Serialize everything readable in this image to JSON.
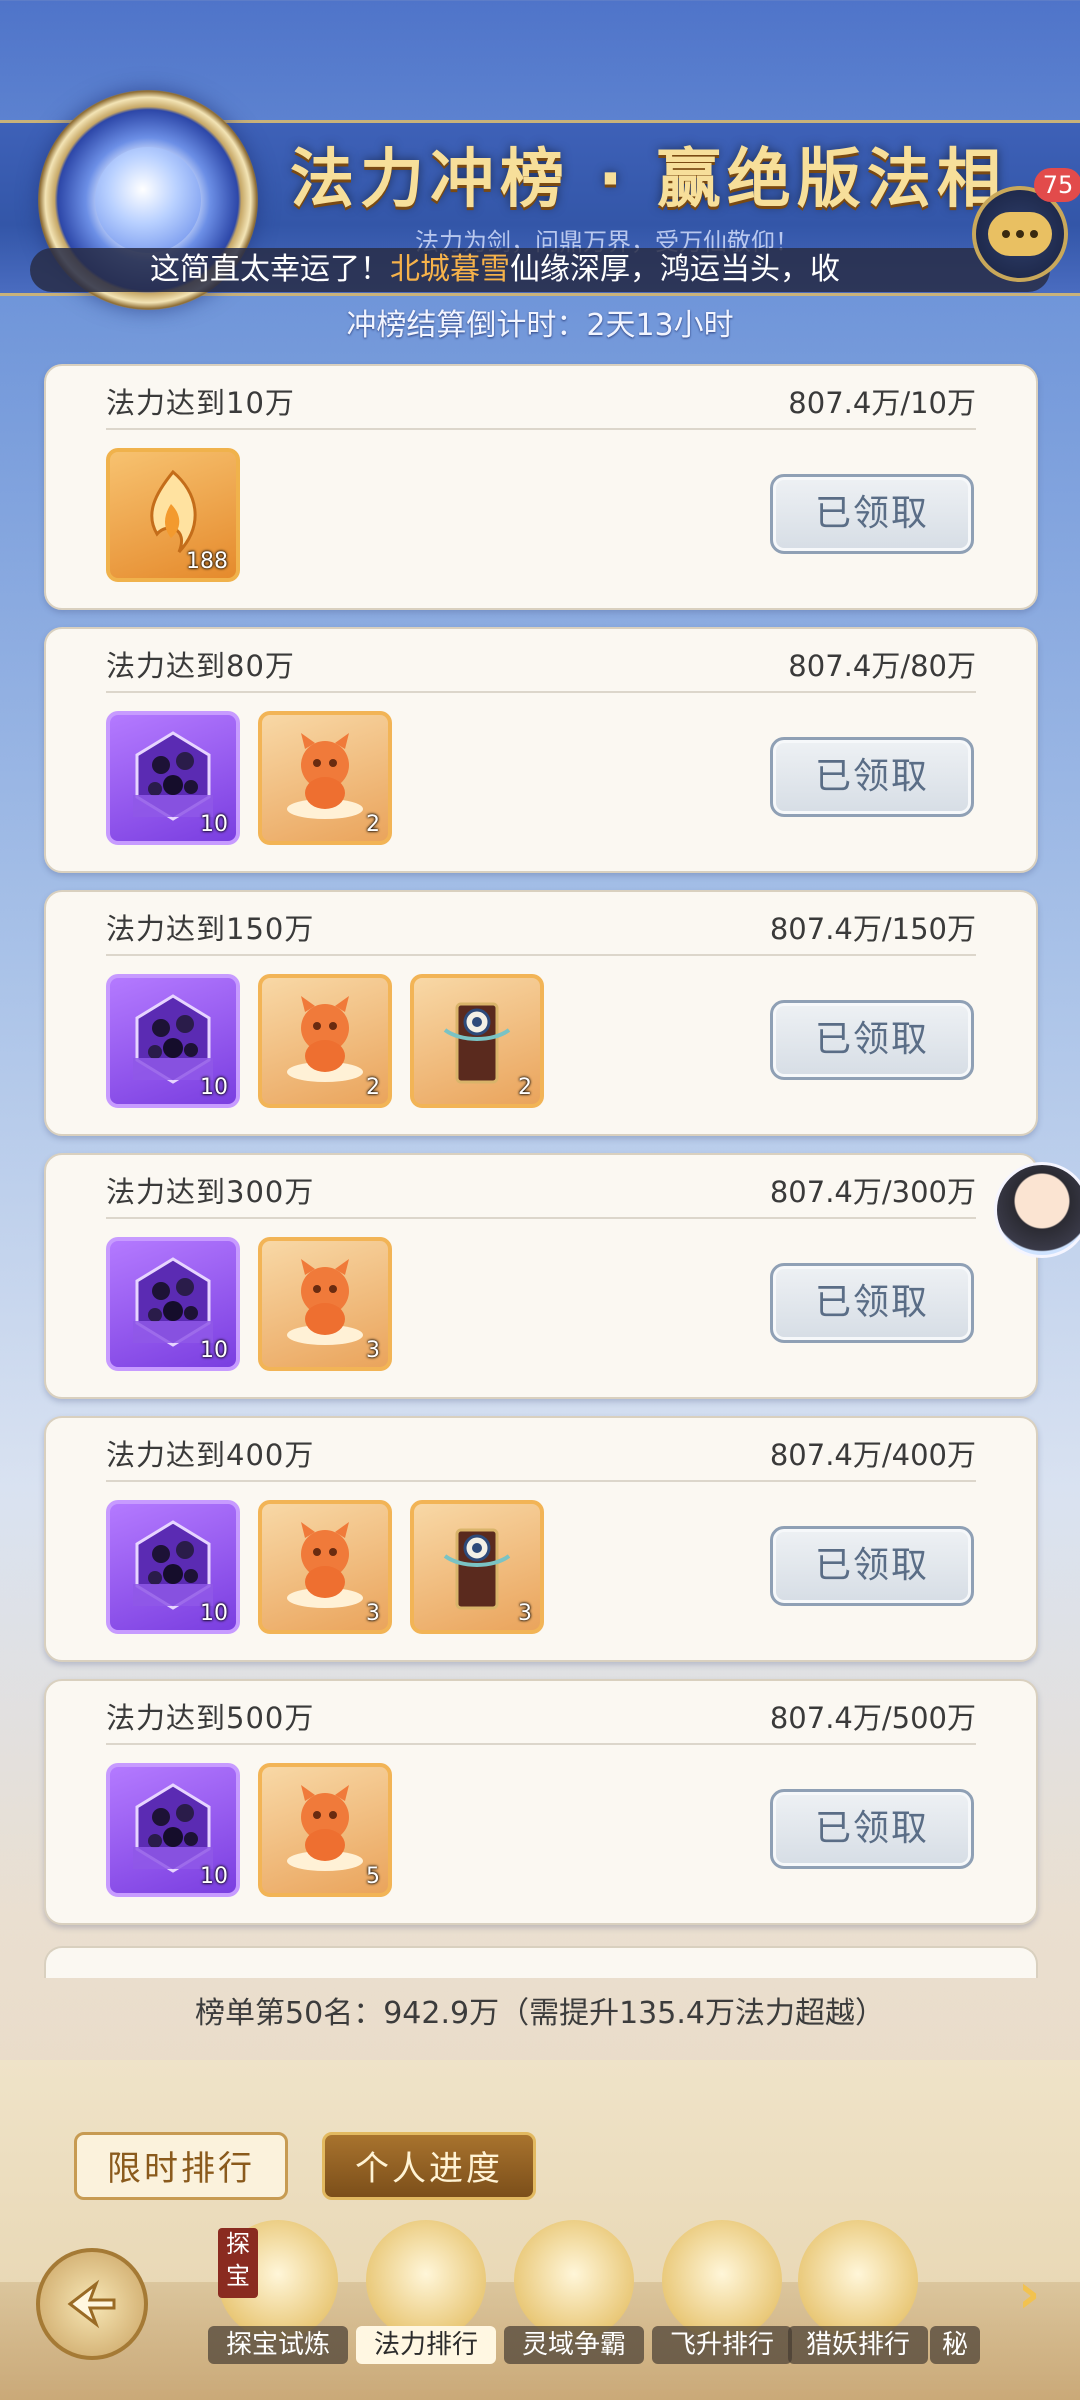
{
  "header": {
    "title": "法力冲榜 · 赢绝版法相",
    "subtitle": "法力为剑，问鼎万界，受万仙敬仰！",
    "chat_badge": "75",
    "marquee_prefix": "这简直太幸运了！",
    "marquee_name": "北城暮雪",
    "marquee_suffix": "仙缘深厚，鸿运当头，收",
    "countdown": "冲榜结算倒计时：2天13小时"
  },
  "claim_label": "已领取",
  "tiers": [
    {
      "title": "法力达到10万",
      "progress": "807.4万/10万",
      "rewards": [
        {
          "type": "gold-flame",
          "count": "188"
        }
      ]
    },
    {
      "title": "法力达到80万",
      "progress": "807.4万/80万",
      "rewards": [
        {
          "type": "purple-crystal",
          "count": "10"
        },
        {
          "type": "orange-beast",
          "count": "2"
        }
      ]
    },
    {
      "title": "法力达到150万",
      "progress": "807.4万/150万",
      "rewards": [
        {
          "type": "purple-crystal",
          "count": "10"
        },
        {
          "type": "orange-beast",
          "count": "2"
        },
        {
          "type": "talisman",
          "count": "2"
        }
      ]
    },
    {
      "title": "法力达到300万",
      "progress": "807.4万/300万",
      "rewards": [
        {
          "type": "purple-crystal",
          "count": "10"
        },
        {
          "type": "orange-beast",
          "count": "3"
        }
      ]
    },
    {
      "title": "法力达到400万",
      "progress": "807.4万/400万",
      "rewards": [
        {
          "type": "purple-crystal",
          "count": "10"
        },
        {
          "type": "orange-beast",
          "count": "3"
        },
        {
          "type": "talisman",
          "count": "3"
        }
      ]
    },
    {
      "title": "法力达到500万",
      "progress": "807.4万/500万",
      "rewards": [
        {
          "type": "purple-crystal",
          "count": "10"
        },
        {
          "type": "orange-beast",
          "count": "5"
        }
      ]
    }
  ],
  "rank_info": "榜单第50名：942.9万（需提升135.4万法力超越）",
  "tabs": {
    "limited": "限时排行",
    "personal": "个人进度"
  },
  "nav": [
    {
      "label": "探宝试炼",
      "badge": "探宝"
    },
    {
      "label": "法力排行",
      "active": true
    },
    {
      "label": "灵域争霸"
    },
    {
      "label": "飞升排行"
    },
    {
      "label": "猎妖排行"
    },
    {
      "label": "秘"
    }
  ]
}
